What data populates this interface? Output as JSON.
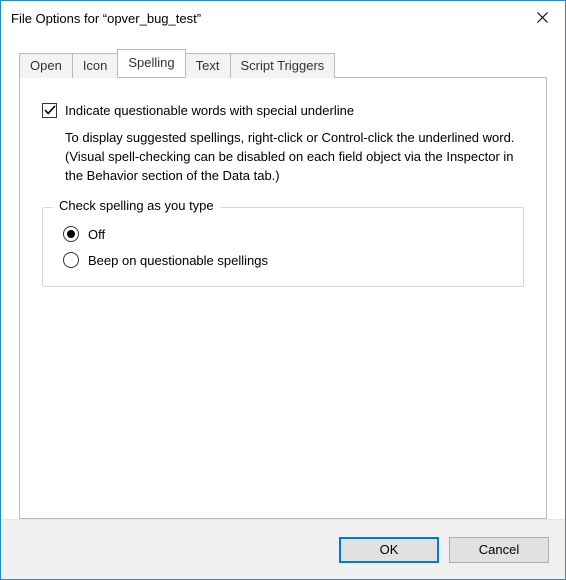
{
  "window": {
    "title": "File Options for “opver_bug_test”"
  },
  "tabs": [
    {
      "label": "Open",
      "active": false
    },
    {
      "label": "Icon",
      "active": false
    },
    {
      "label": "Spelling",
      "active": true
    },
    {
      "label": "Text",
      "active": false
    },
    {
      "label": "Script Triggers",
      "active": false
    }
  ],
  "spelling": {
    "indicate_checkbox": {
      "checked": true,
      "label": "Indicate questionable words with special underline"
    },
    "description": "To display suggested spellings, right-click or Control-click the underlined word. (Visual spell-checking can be disabled on each field object via the Inspector in the Behavior section of the Data tab.)",
    "group": {
      "legend": "Check spelling as you type",
      "options": [
        {
          "label": "Off",
          "selected": true
        },
        {
          "label": "Beep on questionable spellings",
          "selected": false
        }
      ]
    }
  },
  "footer": {
    "ok": "OK",
    "cancel": "Cancel"
  }
}
